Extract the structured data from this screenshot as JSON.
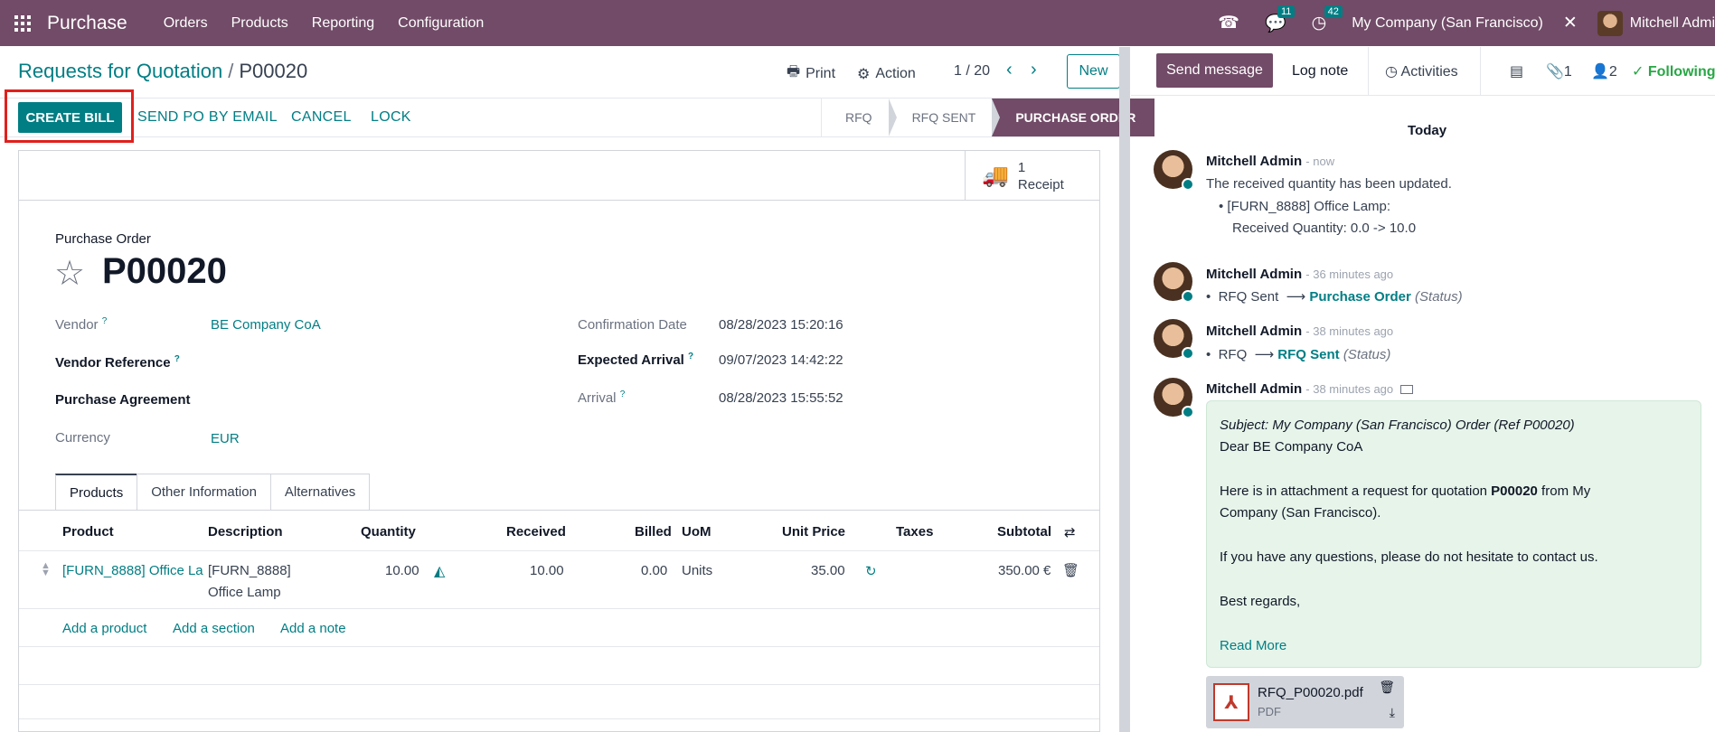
{
  "navbar": {
    "app_name": "Purchase",
    "menus": [
      "Orders",
      "Products",
      "Reporting",
      "Configuration"
    ],
    "messages_count": "11",
    "activities_count": "42",
    "company": "My Company (San Francisco)",
    "user": "Mitchell Admi"
  },
  "control_panel": {
    "breadcrumb_parent": "Requests for Quotation",
    "breadcrumb_sep": "/",
    "breadcrumb_current": "P00020",
    "print_label": "Print",
    "action_label": "Action",
    "pager": "1 / 20",
    "new_label": "New"
  },
  "status_bar": {
    "create_bill": "CREATE BILL",
    "send_po_email": "SEND PO BY EMAIL",
    "cancel": "CANCEL",
    "lock": "LOCK",
    "stages": [
      "RFQ",
      "RFQ SENT",
      "PURCHASE ORDER"
    ],
    "active_stage": "PURCHASE ORDER"
  },
  "smart_button": {
    "count": "1",
    "label": "Receipt"
  },
  "form": {
    "title_label": "Purchase Order",
    "po_number": "P00020",
    "vendor_label": "Vendor",
    "vendor_value": "BE Company CoA",
    "vendor_ref_label": "Vendor Reference",
    "agreement_label": "Purchase Agreement",
    "currency_label": "Currency",
    "currency_value": "EUR",
    "confirmation_label": "Confirmation Date",
    "confirmation_value": "08/28/2023 15:20:16",
    "expected_label": "Expected Arrival",
    "expected_value": "09/07/2023 14:42:22",
    "arrival_label": "Arrival",
    "arrival_value": "08/28/2023 15:55:52",
    "help_mark": "?"
  },
  "tabs": [
    "Products",
    "Other Information",
    "Alternatives"
  ],
  "lines_table": {
    "headers": [
      "Product",
      "Description",
      "Quantity",
      "Received",
      "Billed",
      "UoM",
      "Unit Price",
      "Taxes",
      "Subtotal"
    ],
    "row": {
      "product": "[FURN_8888] Office La",
      "description_1": "[FURN_8888]",
      "description_2": "Office Lamp",
      "quantity": "10.00",
      "received": "10.00",
      "billed": "0.00",
      "uom": "Units",
      "unit_price": "35.00",
      "subtotal": "350.00 €"
    },
    "add_product": "Add a product",
    "add_section": "Add a section",
    "add_note": "Add a note"
  },
  "chatter": {
    "send_message": "Send message",
    "log_note": "Log note",
    "activities": "Activities",
    "attachments_count": "1",
    "followers_count": "2",
    "following": "Following",
    "today": "Today",
    "messages": [
      {
        "author": "Mitchell Admin",
        "time": "- now",
        "text": "The received quantity has been updated.",
        "bullet_1": "[FURN_8888] Office Lamp:",
        "bullet_2": "Received Quantity: 0.0 -> 10.0"
      },
      {
        "author": "Mitchell Admin",
        "time": "- 36 minutes ago",
        "old": "RFQ Sent",
        "new": "Purchase Order",
        "field": "(Status)"
      },
      {
        "author": "Mitchell Admin",
        "time": "- 38 minutes ago",
        "old": "RFQ",
        "new": "RFQ Sent",
        "field": "(Status)"
      },
      {
        "author": "Mitchell Admin",
        "time": "- 38 minutes ago"
      }
    ],
    "email": {
      "subject": "Subject: My Company (San Francisco) Order (Ref P00020)",
      "greeting": "Dear BE Company CoA",
      "body_1_pre": "Here is in attachment a request for quotation ",
      "body_1_bold": "P00020",
      "body_1_post": " from My",
      "body_2": "Company (San Francisco).",
      "body_3": "If you have any questions, please do not hesitate to contact us.",
      "signoff": "Best regards,",
      "read_more": "Read More"
    },
    "attachment": {
      "name": "RFQ_P00020.pdf",
      "type": "PDF"
    }
  },
  "colors": {
    "brand": "#714b67",
    "accent": "#017e84",
    "highlight": "#e0201d",
    "following": "#28a745"
  }
}
